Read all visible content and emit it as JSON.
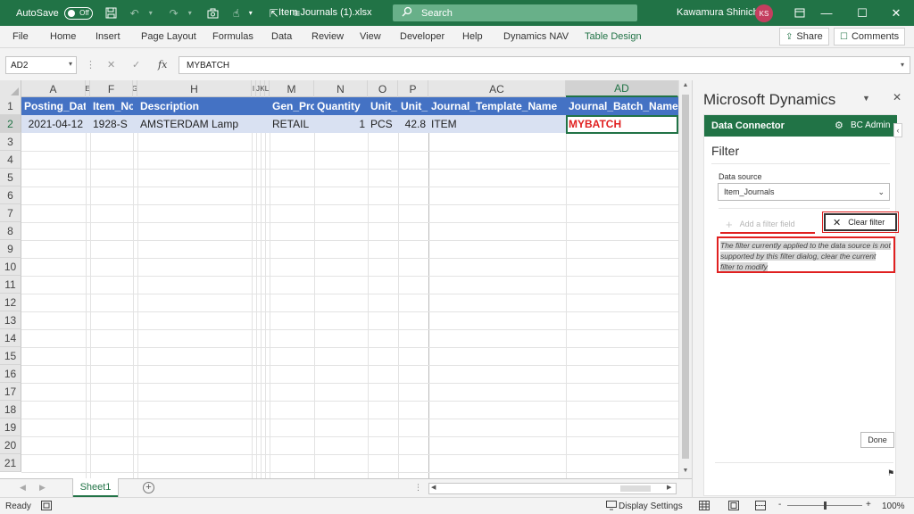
{
  "titlebar": {
    "autosave_label": "AutoSave",
    "autosave_state": "Off",
    "filename": "Item Journals (1).xlsx",
    "search_placeholder": "Search",
    "user_name": "Kawamura Shinichi",
    "user_initials": "KS",
    "icons": [
      "save-icon",
      "undo-icon",
      "redo-icon",
      "camera-icon",
      "touch-mode-icon",
      "pointer-icon",
      "customize-icon",
      "ribbon-display-icon",
      "minimize-icon",
      "maximize-icon",
      "close-icon"
    ]
  },
  "ribbon": {
    "tabs": [
      "File",
      "Home",
      "Insert",
      "Page Layout",
      "Formulas",
      "Data",
      "Review",
      "View",
      "Developer",
      "Help",
      "Dynamics NAV",
      "Table Design"
    ],
    "active_tab": "Table Design",
    "share_label": "Share",
    "comments_label": "Comments"
  },
  "formula_bar": {
    "name_box": "AD2",
    "formula": "MYBATCH",
    "fx": "fx"
  },
  "grid": {
    "columns": [
      "A",
      "E",
      "F",
      "G",
      "H",
      "I",
      "J",
      "K",
      "L",
      "M",
      "N",
      "O",
      "P",
      "AC",
      "AD"
    ],
    "selected_column": "AD",
    "rows": [
      "1",
      "2",
      "3",
      "4",
      "5",
      "6",
      "7",
      "8",
      "9",
      "10",
      "11",
      "12",
      "13",
      "14",
      "15",
      "16",
      "17",
      "18",
      "19",
      "20",
      "21"
    ],
    "headers": {
      "posting_date": "Posting_Dat",
      "item_no": "Item_No",
      "description": "Description",
      "gen_prod": "Gen_Pro",
      "quantity": "Quantity",
      "unit_of_measure": "Unit_",
      "unit_amount": "Unit_",
      "journal_template": "Journal_Template_Name",
      "journal_batch": "Journal_Batch_Name"
    },
    "row2": {
      "posting_date": "2021-04-12",
      "item_no": "1928-S",
      "description": "AMSTERDAM Lamp",
      "gen_prod": "RETAIL",
      "quantity": "1",
      "unit_of_measure": "PCS",
      "unit_amount": "42.8",
      "journal_template": "ITEM",
      "journal_batch": "MYBATCH"
    },
    "header_color": "#4472c4",
    "data_row_color": "#d9e1f2",
    "highlight_color": "#e02020"
  },
  "sheets": {
    "active": "Sheet1"
  },
  "status": {
    "ready": "Ready",
    "display_settings": "Display Settings",
    "zoom": "100%",
    "minus": "-",
    "plus": "+"
  },
  "pane": {
    "title": "Microsoft Dynamics",
    "connector_title": "Data Connector",
    "user": "BC Admin",
    "filter_title": "Filter",
    "data_source_label": "Data source",
    "data_source_value": "Item_Journals",
    "add_filter_label": "Add a filter field",
    "clear_filter_label": "Clear filter",
    "warning": "The filter currently applied to the data source is not supported by this filter dialog, clear the current filter to modify",
    "done_label": "Done",
    "accent_color": "#217346"
  }
}
